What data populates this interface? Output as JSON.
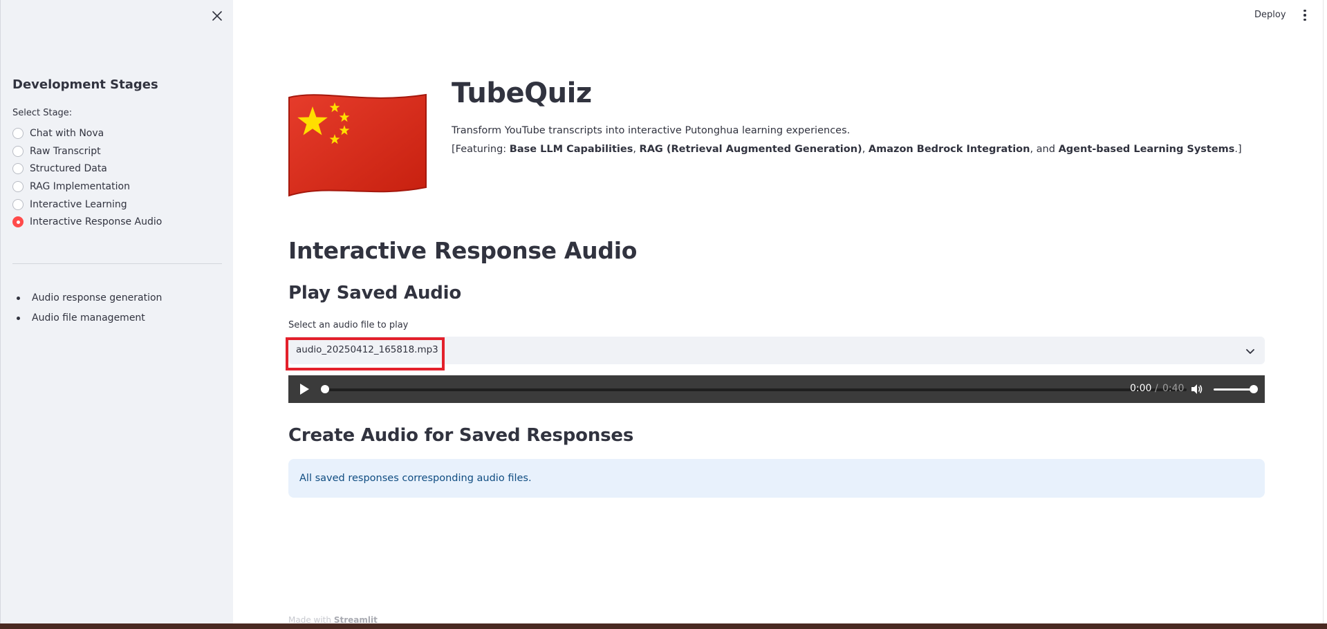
{
  "header": {
    "deploy_label": "Deploy",
    "menu_icon": "more-vertical-icon"
  },
  "sidebar": {
    "close_icon": "close-icon",
    "title": "Development Stages",
    "select_label": "Select Stage:",
    "options": [
      {
        "label": "Chat with Nova",
        "selected": false
      },
      {
        "label": "Raw Transcript",
        "selected": false
      },
      {
        "label": "Structured Data",
        "selected": false
      },
      {
        "label": "RAG Implementation",
        "selected": false
      },
      {
        "label": "Interactive Learning",
        "selected": false
      },
      {
        "label": "Interactive Response Audio",
        "selected": true
      }
    ],
    "bullets": [
      "Audio response generation",
      "Audio file management"
    ]
  },
  "main": {
    "flag_icon": "china-flag-icon",
    "title": "TubeQuiz",
    "subtitle": "Transform YouTube transcripts into interactive Putonghua learning experiences.",
    "features": {
      "prefix": "[Featuring: ",
      "f1": "Base LLM Capabilities",
      "sep1": ", ",
      "f2": "RAG (Retrieval Augmented Generation)",
      "sep2": ", ",
      "f3": "Amazon Bedrock Integration",
      "sep3": ", and ",
      "f4": "Agent-based Learning Systems",
      "suffix": ".]"
    },
    "page_heading": "Interactive Response Audio",
    "play_heading": "Play Saved Audio",
    "select_label": "Select an audio file to play",
    "selected_file": "audio_20250412_165818.mp3",
    "audio": {
      "current_time": "0:00",
      "separator": "/",
      "total_time": "0:40",
      "progress": 0.0,
      "volume": 1.0
    },
    "create_heading": "Create Audio for Saved Responses",
    "info_text": "All saved responses corresponding audio files."
  },
  "footer": {
    "made_with": "Made with",
    "brand": "Streamlit"
  },
  "colors": {
    "accent": "#ff4b4b",
    "sidebar_bg": "#f0f2f6",
    "info_bg": "#e8f1fc",
    "info_text": "#0f4c81",
    "highlight": "#e3202b"
  }
}
